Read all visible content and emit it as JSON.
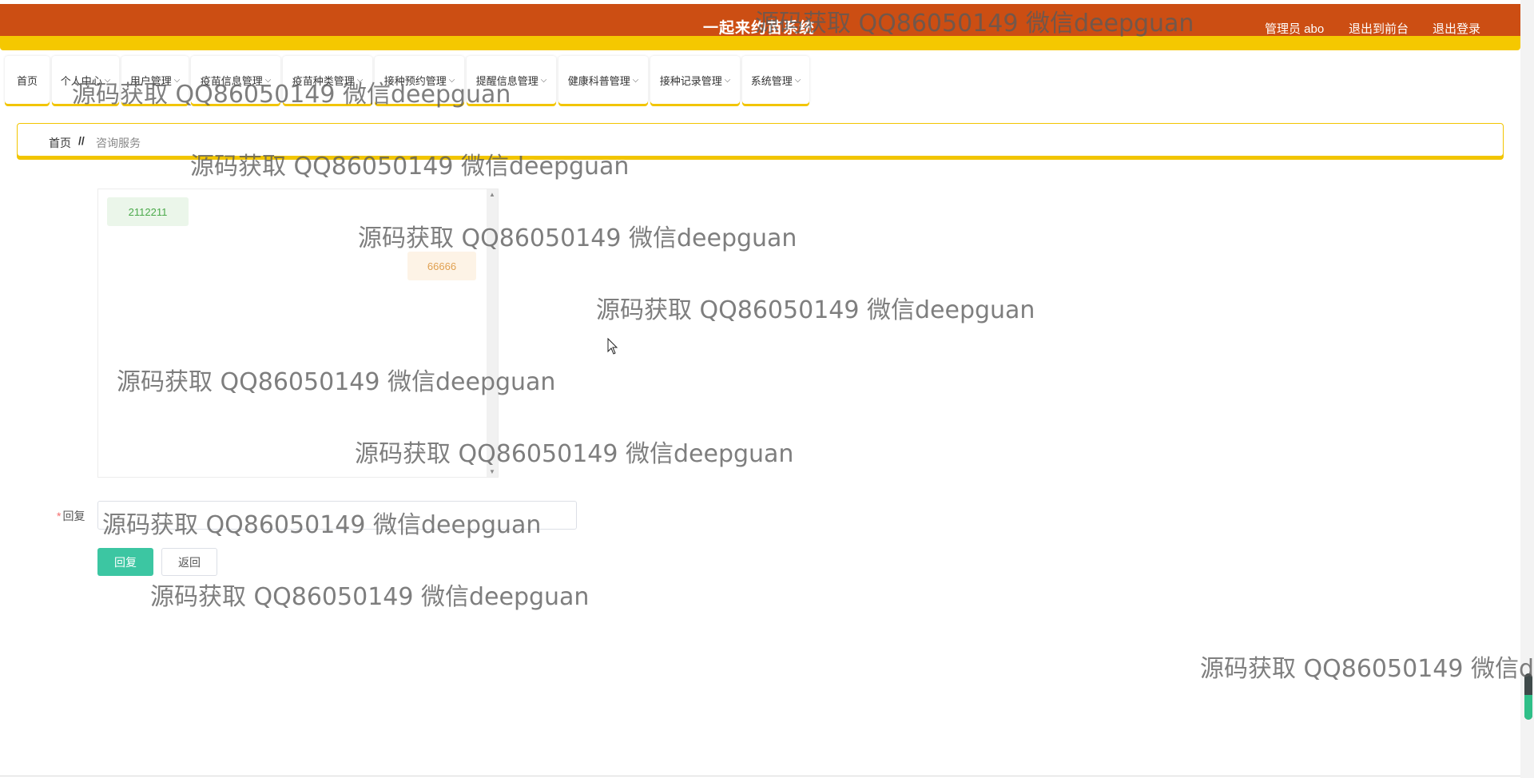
{
  "header": {
    "title": "一起来约苗系统",
    "admin_label": "管理员 abo",
    "to_front_label": "退出到前台",
    "logout_label": "退出登录"
  },
  "nav": {
    "items": [
      {
        "label": "首页",
        "has_dropdown": false
      },
      {
        "label": "个人中心",
        "has_dropdown": true
      },
      {
        "label": "用户管理",
        "has_dropdown": true
      },
      {
        "label": "疫苗信息管理",
        "has_dropdown": true
      },
      {
        "label": "疫苗种类管理",
        "has_dropdown": true
      },
      {
        "label": "接种预约管理",
        "has_dropdown": true
      },
      {
        "label": "提醒信息管理",
        "has_dropdown": true
      },
      {
        "label": "健康科普管理",
        "has_dropdown": true
      },
      {
        "label": "接种记录管理",
        "has_dropdown": true
      },
      {
        "label": "系统管理",
        "has_dropdown": true
      }
    ]
  },
  "breadcrumb": {
    "home": "首页",
    "separator": "//",
    "current": "咨询服务"
  },
  "chat": {
    "messages": [
      {
        "side": "left",
        "text": "2112211"
      },
      {
        "side": "right",
        "text": "66666"
      }
    ]
  },
  "reply_form": {
    "required_mark": "*",
    "label": "回复",
    "value": "",
    "placeholder": "",
    "reply_button": "回复",
    "back_button": "返回"
  },
  "watermark": {
    "text": "源码获取 QQ86050149 微信deepguan"
  },
  "colors": {
    "header_bg": "#cc4e13",
    "accent_yellow": "#f5c800",
    "primary_button": "#3cc6a2",
    "msg_left_bg": "#ebf6ea",
    "msg_left_text": "#4caa4c",
    "msg_right_bg": "#fdf3e6",
    "msg_right_text": "#e0a050"
  },
  "icons": {
    "dropdown": "chevron-down-icon",
    "cursor": "mouse-pointer-icon"
  }
}
